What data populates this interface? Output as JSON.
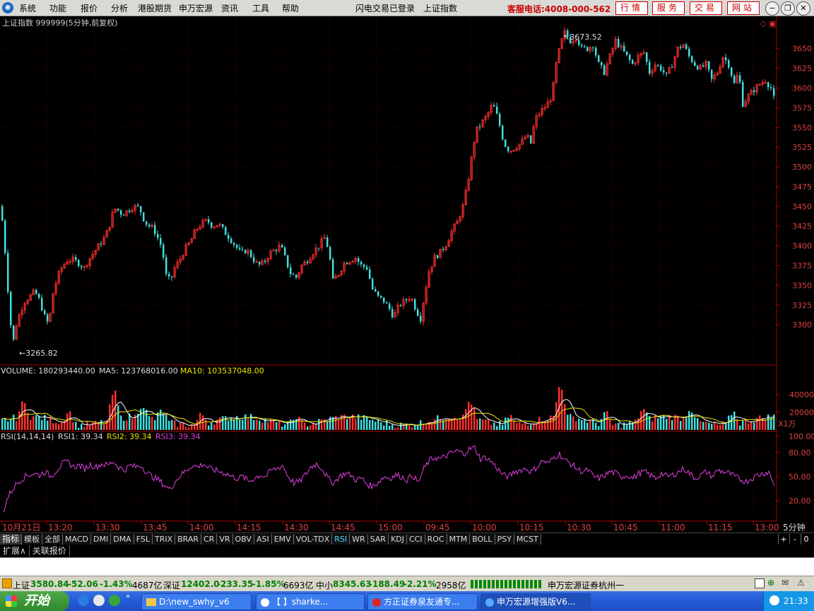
{
  "menu": {
    "items": [
      "系统",
      "功能",
      "报价",
      "分析",
      "港股期货",
      "申万宏源",
      "资讯",
      "工具",
      "帮助"
    ],
    "center1": "闪电交易已登录",
    "center2": "上证指数",
    "phone": "客服电话:4008-000-562",
    "right_buttons": [
      "行情",
      "服务",
      "交易",
      "网站"
    ]
  },
  "chart_header": "上证指数 999999(5分钟,前复权)",
  "price_labels": {
    "high": "3673.52",
    "low": "3265.82"
  },
  "volume_header": {
    "label": "VOLUME: 180293440.00",
    "ma5": "MA5: 123768016.00",
    "ma10": "MA10: 103537048.00"
  },
  "volume_unit": "X1万",
  "rsi_header": {
    "label": "RSI(14,14,14)",
    "rsi1": "RSI1: 39.34",
    "rsi2": "RSI2: 39.34",
    "rsi3": "RSI3: 39.34"
  },
  "period_label": "5分钟",
  "indicator_tabs": [
    "指标",
    "模板",
    "全部",
    "MACD",
    "DMI",
    "DMA",
    "FSL",
    "TRIX",
    "BRAR",
    "CR",
    "VR",
    "OBV",
    "ASI",
    "EMV",
    "VOL-TDX",
    "RSI",
    "WR",
    "SAR",
    "KDJ",
    "CCI",
    "ROC",
    "MTM",
    "BOLL",
    "PSY",
    "MCST"
  ],
  "selected_tab": "RSI",
  "right_small": [
    "+",
    "-",
    "0"
  ],
  "ext_tabs": [
    "扩展∧",
    "关联报价"
  ],
  "status": {
    "sh_label": "上证",
    "sh_value": "3580.84",
    "sh_change": "-52.06",
    "sh_pct": "-1.43%",
    "sh_amount": "4687亿",
    "sz_label": "深证",
    "sz_value": "12402.0",
    "sz_change": "-233.35",
    "sz_pct": "-1.85%",
    "sz_amount": "6693亿",
    "zx_label": "中小",
    "zx_value": "8345.63",
    "zx_change": "-188.49",
    "zx_pct": "-2.21%",
    "zx_amount": "2958亿",
    "broker": "申万宏源证券杭州一"
  },
  "taskbar": {
    "start": "开始",
    "tasks": [
      "D:\\new_swhy_v6",
      "【          】sharke...",
      "方正证券泉友通专...",
      "申万宏源增强版V6..."
    ],
    "clock": "21:33"
  },
  "chart_data": [
    {
      "type": "candlestick",
      "title": "上证指数 999999(5分钟,前复权)",
      "y_ticks": [
        3300,
        3325,
        3350,
        3375,
        3400,
        3425,
        3450,
        3475,
        3500,
        3525,
        3550,
        3575,
        3600,
        3625,
        3650
      ],
      "x_tick_labels": [
        "10月21日",
        "13:20",
        "13:30",
        "13:45",
        "14:00",
        "14:15",
        "14:30",
        "14:45",
        "15:00",
        "09:45",
        "10:00",
        "10:15",
        "10:30",
        "10:45",
        "11:00",
        "11:15",
        "13:00"
      ],
      "ylim": [
        3258,
        3682
      ],
      "annotations": [
        {
          "text": "3673.52",
          "type": "high"
        },
        {
          "text": "3265.82",
          "type": "low"
        }
      ],
      "close_path": [
        [
          0,
          3450
        ],
        [
          5,
          3405
        ],
        [
          10,
          3345
        ],
        [
          14,
          3300
        ],
        [
          18,
          3280
        ],
        [
          22,
          3300
        ],
        [
          28,
          3318
        ],
        [
          34,
          3330
        ],
        [
          40,
          3335
        ],
        [
          48,
          3342
        ],
        [
          55,
          3330
        ],
        [
          62,
          3310
        ],
        [
          68,
          3300
        ],
        [
          74,
          3340
        ],
        [
          80,
          3360
        ],
        [
          86,
          3372
        ],
        [
          94,
          3382
        ],
        [
          102,
          3382
        ],
        [
          110,
          3378
        ],
        [
          118,
          3372
        ],
        [
          124,
          3382
        ],
        [
          132,
          3392
        ],
        [
          140,
          3402
        ],
        [
          148,
          3412
        ],
        [
          156,
          3432
        ],
        [
          160,
          3448
        ],
        [
          166,
          3445
        ],
        [
          172,
          3440
        ],
        [
          180,
          3445
        ],
        [
          188,
          3450
        ],
        [
          196,
          3448
        ],
        [
          204,
          3430
        ],
        [
          210,
          3425
        ],
        [
          216,
          3422
        ],
        [
          222,
          3410
        ],
        [
          228,
          3398
        ],
        [
          234,
          3362
        ],
        [
          240,
          3355
        ],
        [
          246,
          3372
        ],
        [
          252,
          3380
        ],
        [
          260,
          3395
        ],
        [
          268,
          3405
        ],
        [
          276,
          3420
        ],
        [
          284,
          3428
        ],
        [
          292,
          3432
        ],
        [
          300,
          3425
        ],
        [
          308,
          3428
        ],
        [
          316,
          3418
        ],
        [
          324,
          3410
        ],
        [
          332,
          3400
        ],
        [
          340,
          3390
        ],
        [
          348,
          3395
        ],
        [
          356,
          3385
        ],
        [
          364,
          3375
        ],
        [
          372,
          3378
        ],
        [
          380,
          3390
        ],
        [
          388,
          3395
        ],
        [
          396,
          3400
        ],
        [
          404,
          3380
        ],
        [
          410,
          3365
        ],
        [
          418,
          3360
        ],
        [
          426,
          3375
        ],
        [
          434,
          3382
        ],
        [
          442,
          3392
        ],
        [
          450,
          3400
        ],
        [
          458,
          3410
        ],
        [
          464,
          3395
        ],
        [
          470,
          3355
        ],
        [
          478,
          3365
        ],
        [
          486,
          3378
        ],
        [
          494,
          3382
        ],
        [
          502,
          3385
        ],
        [
          510,
          3375
        ],
        [
          518,
          3372
        ],
        [
          526,
          3345
        ],
        [
          534,
          3335
        ],
        [
          542,
          3330
        ],
        [
          550,
          3320
        ],
        [
          556,
          3310
        ],
        [
          564,
          3325
        ],
        [
          572,
          3330
        ],
        [
          580,
          3336
        ],
        [
          588,
          3318
        ],
        [
          594,
          3308
        ],
        [
          600,
          3340
        ],
        [
          606,
          3368
        ],
        [
          614,
          3385
        ],
        [
          622,
          3392
        ],
        [
          630,
          3402
        ],
        [
          638,
          3418
        ],
        [
          646,
          3430
        ],
        [
          654,
          3450
        ],
        [
          660,
          3475
        ],
        [
          666,
          3510
        ],
        [
          672,
          3545
        ],
        [
          680,
          3555
        ],
        [
          688,
          3565
        ],
        [
          696,
          3580
        ],
        [
          704,
          3560
        ],
        [
          712,
          3530
        ],
        [
          720,
          3520
        ],
        [
          728,
          3525
        ],
        [
          736,
          3530
        ],
        [
          744,
          3540
        ],
        [
          750,
          3530
        ],
        [
          756,
          3560
        ],
        [
          764,
          3570
        ],
        [
          772,
          3578
        ],
        [
          780,
          3590
        ],
        [
          786,
          3630
        ],
        [
          792,
          3655
        ],
        [
          798,
          3670
        ],
        [
          806,
          3660
        ],
        [
          814,
          3665
        ],
        [
          822,
          3650
        ],
        [
          830,
          3650
        ],
        [
          838,
          3655
        ],
        [
          846,
          3630
        ],
        [
          854,
          3620
        ],
        [
          862,
          3640
        ],
        [
          870,
          3660
        ],
        [
          878,
          3650
        ],
        [
          886,
          3640
        ],
        [
          894,
          3630
        ],
        [
          902,
          3640
        ],
        [
          910,
          3645
        ],
        [
          918,
          3620
        ],
        [
          926,
          3630
        ],
        [
          934,
          3625
        ],
        [
          942,
          3615
        ],
        [
          950,
          3630
        ],
        [
          958,
          3650
        ],
        [
          966,
          3655
        ],
        [
          974,
          3640
        ],
        [
          982,
          3630
        ],
        [
          990,
          3625
        ],
        [
          998,
          3630
        ],
        [
          1006,
          3610
        ],
        [
          1014,
          3620
        ],
        [
          1022,
          3640
        ],
        [
          1030,
          3630
        ],
        [
          1038,
          3605
        ],
        [
          1044,
          3620
        ],
        [
          1050,
          3580
        ],
        [
          1058,
          3590
        ],
        [
          1066,
          3598
        ],
        [
          1074,
          3605
        ],
        [
          1082,
          3610
        ],
        [
          1090,
          3600
        ],
        [
          1096,
          3580
        ]
      ]
    },
    {
      "type": "bar",
      "title": "VOLUME",
      "values_label": "180293440.00",
      "y_ticks": [
        20000,
        40000
      ],
      "unit": "X1万",
      "series": [
        {
          "name": "MA5",
          "value": 123768016.0
        },
        {
          "name": "MA10",
          "value": 103537048.0
        }
      ]
    },
    {
      "type": "line",
      "title": "RSI(14,14,14)",
      "y_ticks": [
        20.0,
        50.0,
        80.0,
        100.0
      ],
      "ylim": [
        0,
        100
      ],
      "series": [
        {
          "name": "RSI1",
          "last": 39.34,
          "color": "#e040e0"
        },
        {
          "name": "RSI2",
          "last": 39.34,
          "color": "#e040e0"
        },
        {
          "name": "RSI3",
          "last": 39.34,
          "color": "#e040e0"
        }
      ],
      "path": [
        [
          4,
          5
        ],
        [
          10,
          22
        ],
        [
          16,
          32
        ],
        [
          24,
          42
        ],
        [
          32,
          48
        ],
        [
          40,
          52
        ],
        [
          48,
          54
        ],
        [
          56,
          52
        ],
        [
          64,
          56
        ],
        [
          72,
          50
        ],
        [
          80,
          58
        ],
        [
          88,
          66
        ],
        [
          96,
          68
        ],
        [
          104,
          62
        ],
        [
          112,
          64
        ],
        [
          120,
          60
        ],
        [
          128,
          65
        ],
        [
          136,
          62
        ],
        [
          144,
          66
        ],
        [
          152,
          64
        ],
        [
          160,
          69
        ],
        [
          168,
          62
        ],
        [
          176,
          58
        ],
        [
          184,
          64
        ],
        [
          192,
          62
        ],
        [
          200,
          64
        ],
        [
          208,
          55
        ],
        [
          216,
          50
        ],
        [
          224,
          46
        ],
        [
          232,
          40
        ],
        [
          240,
          34
        ],
        [
          248,
          44
        ],
        [
          256,
          52
        ],
        [
          264,
          58
        ],
        [
          272,
          64
        ],
        [
          280,
          62
        ],
        [
          288,
          66
        ],
        [
          296,
          60
        ],
        [
          304,
          58
        ],
        [
          312,
          56
        ],
        [
          320,
          54
        ],
        [
          328,
          50
        ],
        [
          336,
          48
        ],
        [
          344,
          50
        ],
        [
          352,
          44
        ],
        [
          360,
          48
        ],
        [
          368,
          52
        ],
        [
          376,
          50
        ],
        [
          384,
          58
        ],
        [
          392,
          60
        ],
        [
          400,
          64
        ],
        [
          408,
          50
        ],
        [
          416,
          42
        ],
        [
          424,
          44
        ],
        [
          432,
          52
        ],
        [
          440,
          62
        ],
        [
          448,
          66
        ],
        [
          456,
          60
        ],
        [
          464,
          48
        ],
        [
          472,
          42
        ],
        [
          480,
          50
        ],
        [
          488,
          54
        ],
        [
          496,
          52
        ],
        [
          504,
          46
        ],
        [
          512,
          48
        ],
        [
          520,
          40
        ],
        [
          528,
          38
        ],
        [
          536,
          44
        ],
        [
          544,
          50
        ],
        [
          552,
          48
        ],
        [
          560,
          52
        ],
        [
          568,
          50
        ],
        [
          576,
          46
        ],
        [
          584,
          52
        ],
        [
          592,
          42
        ],
        [
          600,
          60
        ],
        [
          608,
          70
        ],
        [
          616,
          74
        ],
        [
          624,
          72
        ],
        [
          632,
          76
        ],
        [
          640,
          80
        ],
        [
          648,
          82
        ],
        [
          656,
          78
        ],
        [
          664,
          84
        ],
        [
          672,
          86
        ],
        [
          680,
          72
        ],
        [
          688,
          74
        ],
        [
          696,
          68
        ],
        [
          704,
          60
        ],
        [
          712,
          52
        ],
        [
          720,
          50
        ],
        [
          728,
          56
        ],
        [
          736,
          58
        ],
        [
          744,
          60
        ],
        [
          752,
          56
        ],
        [
          760,
          62
        ],
        [
          768,
          70
        ],
        [
          776,
          66
        ],
        [
          784,
          74
        ],
        [
          792,
          78
        ],
        [
          800,
          70
        ],
        [
          808,
          66
        ],
        [
          816,
          60
        ],
        [
          824,
          56
        ],
        [
          832,
          58
        ],
        [
          840,
          50
        ],
        [
          848,
          48
        ],
        [
          856,
          52
        ],
        [
          864,
          56
        ],
        [
          872,
          54
        ],
        [
          880,
          50
        ],
        [
          888,
          52
        ],
        [
          896,
          48
        ],
        [
          904,
          54
        ],
        [
          912,
          56
        ],
        [
          920,
          52
        ],
        [
          928,
          48
        ],
        [
          936,
          54
        ],
        [
          944,
          50
        ],
        [
          952,
          52
        ],
        [
          960,
          56
        ],
        [
          968,
          60
        ],
        [
          976,
          54
        ],
        [
          984,
          48
        ],
        [
          992,
          52
        ],
        [
          1000,
          56
        ],
        [
          1008,
          50
        ],
        [
          1016,
          58
        ],
        [
          1024,
          56
        ],
        [
          1032,
          54
        ],
        [
          1040,
          50
        ],
        [
          1048,
          46
        ],
        [
          1056,
          44
        ],
        [
          1064,
          48
        ],
        [
          1072,
          52
        ],
        [
          1080,
          54
        ],
        [
          1088,
          56
        ],
        [
          1096,
          40
        ]
      ]
    }
  ]
}
